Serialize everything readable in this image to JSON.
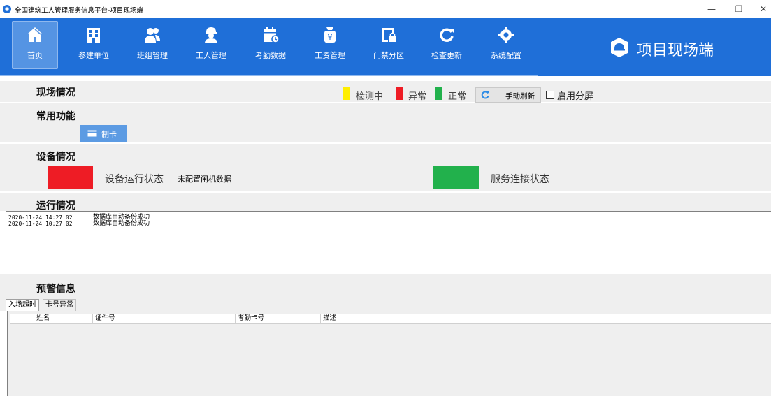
{
  "window": {
    "title": "全国建筑工人管理服务信息平台-项目现场端",
    "controls": [
      "minimize-icon",
      "restore-icon",
      "close-icon"
    ]
  },
  "nav": {
    "items": [
      {
        "label": "首页",
        "icon": "home-icon",
        "active": true
      },
      {
        "label": "参建单位",
        "icon": "building-icon"
      },
      {
        "label": "班组管理",
        "icon": "team-icon"
      },
      {
        "label": "工人管理",
        "icon": "worker-icon"
      },
      {
        "label": "考勤数据",
        "icon": "calendar-icon"
      },
      {
        "label": "工资管理",
        "icon": "salary-icon"
      },
      {
        "label": "门禁分区",
        "icon": "access-door-icon"
      },
      {
        "label": "检查更新",
        "icon": "refresh-icon"
      },
      {
        "label": "系统配置",
        "icon": "gear-icon"
      }
    ],
    "brand": "项目现场端"
  },
  "site": {
    "title": "现场情况",
    "legend": [
      {
        "label": "检测中",
        "color": "#ffee00"
      },
      {
        "label": "异常",
        "color": "#ee1c25"
      },
      {
        "label": "正常",
        "color": "#22b14c"
      }
    ],
    "refresh_label": "手动刷新",
    "split_label": "启用分屏",
    "split_checked": false
  },
  "common": {
    "title": "常用功能",
    "make_card_label": "制卡"
  },
  "device": {
    "title": "设备情况",
    "device_status_label": "设备运行状态",
    "device_status_value": "未配置闸机数据",
    "device_status_color": "#ee1c25",
    "service_status_label": "服务连接状态",
    "service_status_color": "#22b14c"
  },
  "run": {
    "title": "运行情况",
    "log": [
      {
        "time": "2020-11-24 14:27:02",
        "message": "数据库自动备份成功"
      },
      {
        "time": "2020-11-24 10:27:02",
        "message": "数据库自动备份成功"
      }
    ]
  },
  "alerts": {
    "title": "预警信息",
    "tabs": [
      "入场超时",
      "卡号异常"
    ],
    "columns": [
      "姓名",
      "证件号",
      "考勤卡号",
      "描述"
    ],
    "rows": []
  },
  "colors": {
    "nav_bg": "#1f6fd8",
    "section_bg": "#efefef",
    "card_button": "#5c9be3"
  }
}
